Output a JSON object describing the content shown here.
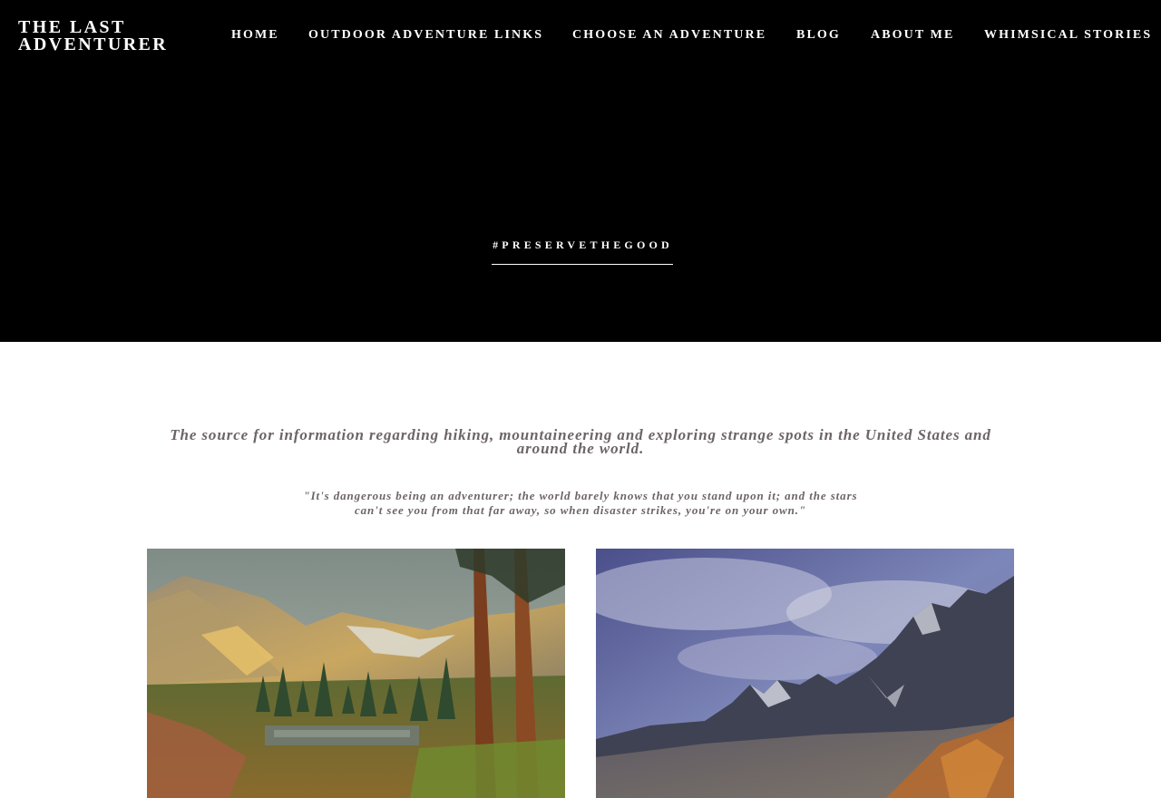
{
  "site": {
    "logo_line1": "THE LAST",
    "logo_line2": "ADVENTURER"
  },
  "nav": {
    "items": [
      {
        "label": "HOME"
      },
      {
        "label": "OUTDOOR ADVENTURE LINKS"
      },
      {
        "label": "CHOOSE AN ADVENTURE"
      },
      {
        "label": "BLOG"
      },
      {
        "label": "ABOUT ME"
      },
      {
        "label": "WHIMSICAL STORIES"
      }
    ]
  },
  "hero": {
    "background": "#000000",
    "hashtag": "#PRESERVETHEGOOD"
  },
  "intro": {
    "tagline": "The source for information regarding hiking, mountaineering and exploring strange spots in the United States and around the world.",
    "quote": "\"It's dangerous being an adventurer; the world barely knows that you stand upon it; and the stars can't see you from that far away, so when disaster strikes, you're on your own.\"",
    "text_color": "#6d6466"
  },
  "gallery": {
    "photos": [
      {
        "subject": "alpine lake with pine trees and rocky peaks"
      },
      {
        "subject": "jagged mountain ridge under cloudy sky"
      }
    ]
  }
}
